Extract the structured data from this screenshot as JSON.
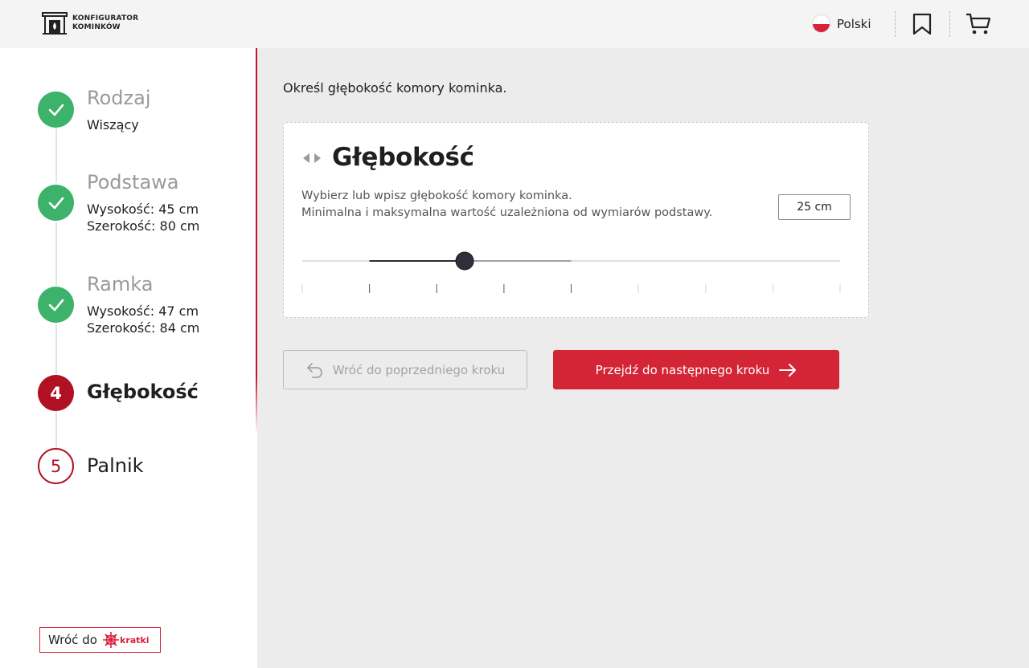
{
  "header": {
    "logo_line1": "KONFIGURATOR",
    "logo_line2": "KOMINKÓW",
    "language": "Polski",
    "icons": [
      "fireplace-logo-icon",
      "poland-flag-icon",
      "bookmark-icon",
      "cart-icon"
    ]
  },
  "steps": [
    {
      "title": "Rodzaj",
      "state": "done",
      "sub": [
        "Wiszący"
      ]
    },
    {
      "title": "Podstawa",
      "state": "done",
      "sub": [
        "Wysokość: 45 cm",
        "Szerokość: 80 cm"
      ]
    },
    {
      "title": "Ramka",
      "state": "done",
      "sub": [
        "Wysokość: 47 cm",
        "Szerokość: 84 cm"
      ]
    },
    {
      "number": "4",
      "title": "Głębokość",
      "state": "active"
    },
    {
      "number": "5",
      "title": "Palnik",
      "state": "future"
    }
  ],
  "back_to": {
    "label": "Wróć do",
    "brand": "kratki"
  },
  "main": {
    "instruction": "Określ głębokość komory kominka.",
    "card": {
      "title": "Głębokość",
      "desc_line1": "Wybierz lub wpisz głębokość komory kominka.",
      "desc_line2": "Minimalna i maksymalna wartość uzależniona od wymiarów podstawy.",
      "value": "25 cm"
    },
    "slider": {
      "ticks": 9,
      "range_start_tick": 1,
      "range_end_tick": 4,
      "thumb_fraction": 0.302
    },
    "back_button": "Wróć do poprzedniego kroku",
    "next_button": "Przejdź do następnego kroku"
  },
  "colors": {
    "accent": "#d42537",
    "active_step": "#b01224",
    "done_step": "#3db26a"
  }
}
